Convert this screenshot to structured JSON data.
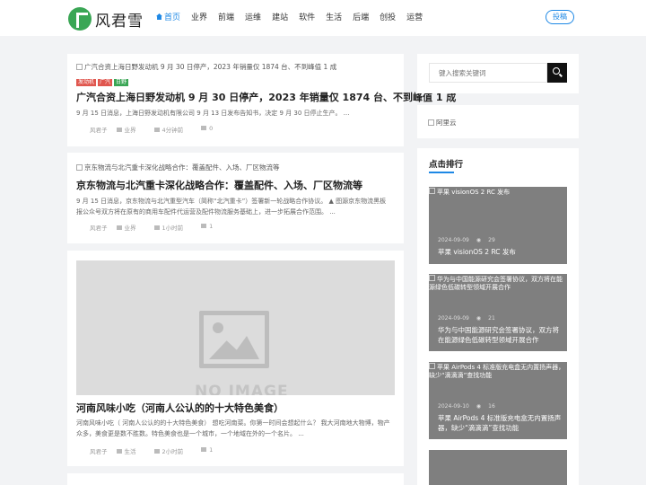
{
  "site": {
    "name": "风君雪",
    "brand_color": "#3aa655"
  },
  "nav": {
    "items": [
      "首页",
      "业界",
      "前端",
      "运维",
      "建站",
      "软件",
      "生活",
      "后端",
      "创投",
      "运营"
    ],
    "active_index": 0,
    "post_label": "投稿",
    "accent": "#1e88e5"
  },
  "posts": [
    {
      "image_alt": "广汽合资上海日野发动机 9 月 30 日停产，2023 年销量仅 1874 台、不到峰值 1 成",
      "tags": [
        {
          "label": "发动机",
          "color": "#e0574f"
        },
        {
          "label": "广汽",
          "color": "#e0574f"
        },
        {
          "label": "日野",
          "color": "#3aa655"
        }
      ],
      "title": "广汽合资上海日野发动机 9 月 30 日停产，2023 年销量仅 1874 台、不到峰值 1 成",
      "excerpt": "9 月 15 日消息，上海日野发动机有限公司 9 月 13 日发布告知书，决定 9 月 30 日停止生产。 ...",
      "author": "风君子",
      "category": "业界",
      "time": "4分钟前",
      "views": "0"
    },
    {
      "image_alt": "京东物流与北汽重卡深化战略合作：覆盖配件、入场、厂区物流等",
      "title": "京东物流与北汽重卡深化战略合作：覆盖配件、入场、厂区物流等",
      "excerpt": "9 月 15 日消息，京东物流与北汽重型汽车（简称“北汽重卡”）签署新一轮战略合作协议。 ▲ 图源京东物流黑板报公众号双方将在原有的商用车配件代运营及配件物流服务基础上，进一步拓展合作范围。 ...",
      "author": "风君子",
      "category": "业界",
      "time": "1小时前",
      "views": "1"
    },
    {
      "placeholder_text": "NO IMAGE",
      "title": "河南风味小吃（河南人公认的的十大特色美食）",
      "excerpt": "河南风味小吃（ 河南人公认的的十大特色美食） 想吃河南菜。你第一时间会想起什么？ 我大河南地大物博，物产众多，美食更是数不胜数。特色美食也是一个城市，一个地域在外的一个名片。 ...",
      "author": "风君子",
      "category": "生活",
      "time": "2小时前",
      "views": "1"
    }
  ],
  "sidebar": {
    "search_placeholder": "键入搜索关键词",
    "ad_alt": "阿里云",
    "rank_title": "点击排行",
    "rank_items": [
      {
        "image_alt": "苹果 visionOS 2 RC 发布",
        "date": "2024-09-09",
        "views": "29",
        "title": "苹果 visionOS 2 RC 发布"
      },
      {
        "image_alt": "华为与中国能源研究会签署协议，双方将在能源绿色低碳转型领域开展合作",
        "date": "2024-09-09",
        "views": "21",
        "title": "华为与中国能源研究会签署协议，双方将在能源绿色低碳转型领域开展合作"
      },
      {
        "image_alt": "苹果 AirPods 4 标准版充电盒无内置扬声器，缺少“滴滴滴”查找功能",
        "date": "2024-09-10",
        "views": "16",
        "title": "苹果 AirPods 4 标准版充电盒无内置扬声器，缺少“滴滴滴”查找功能"
      }
    ]
  }
}
